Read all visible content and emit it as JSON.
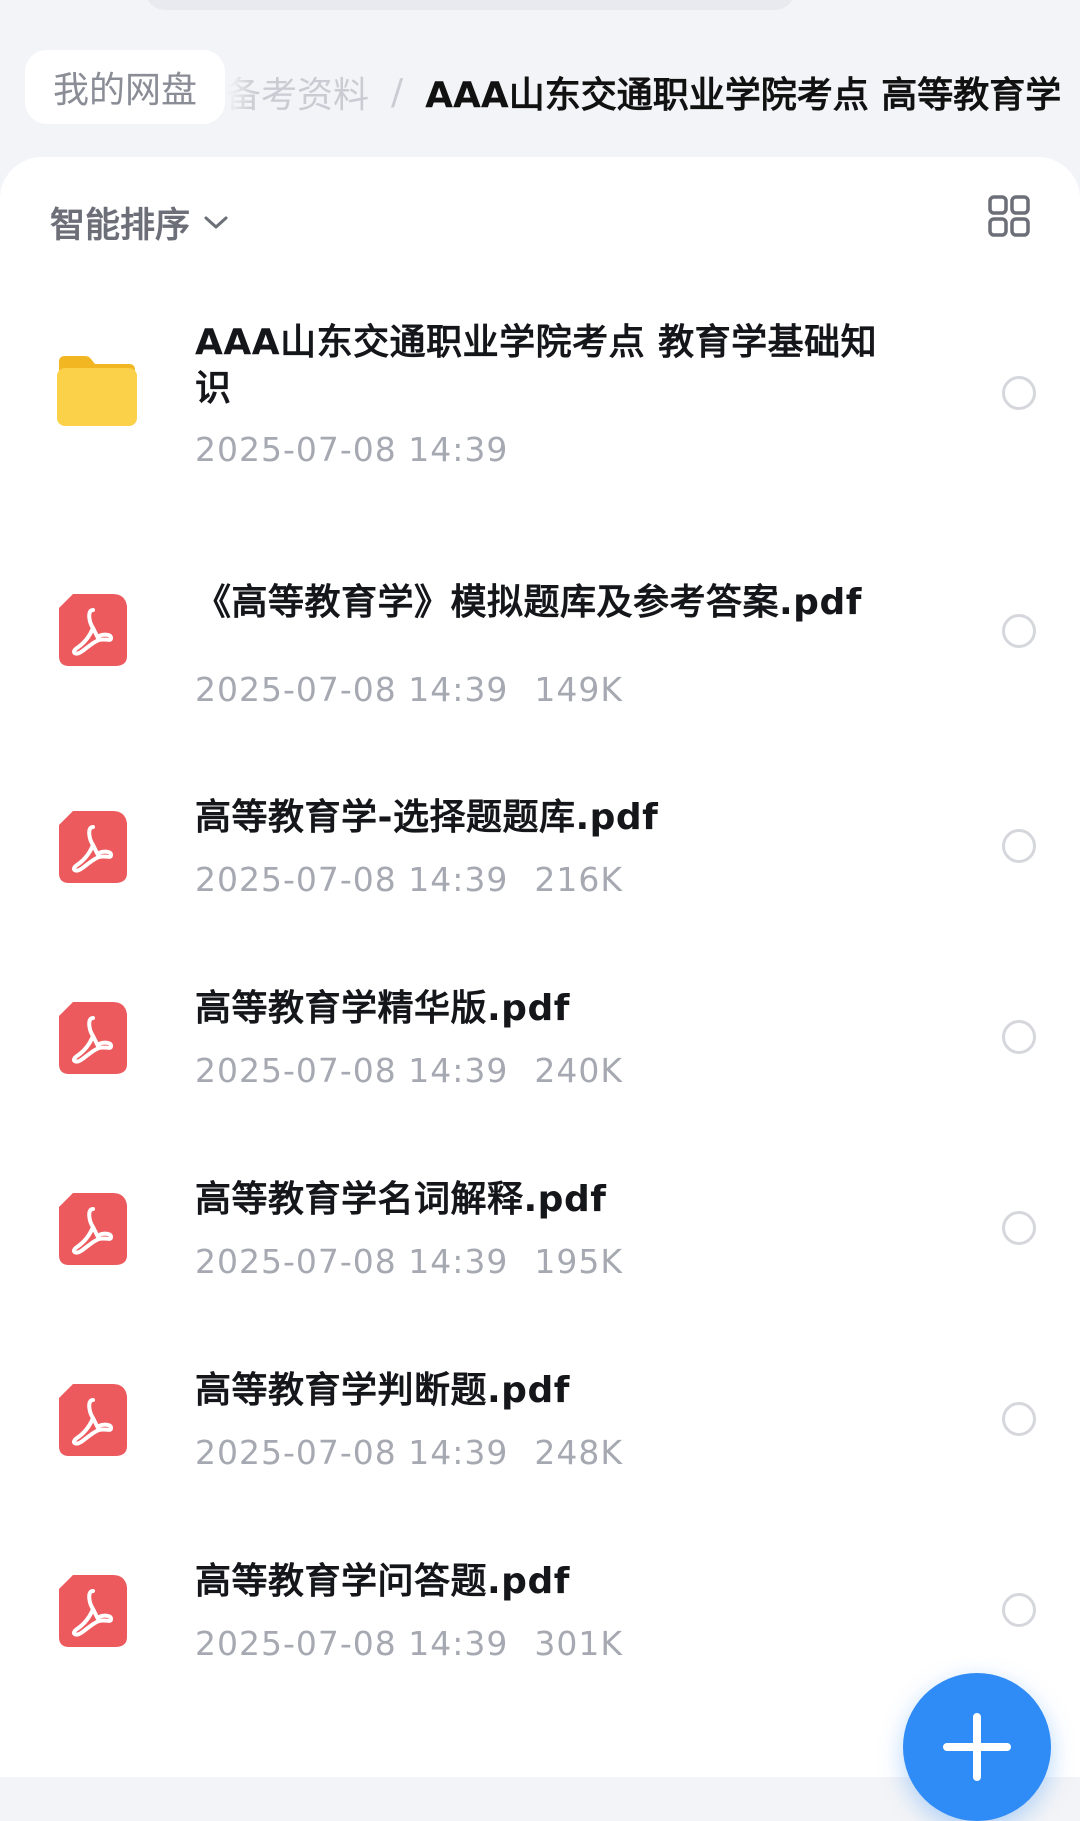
{
  "breadcrumb": {
    "root": "我的网盘",
    "previous": "备考资料",
    "separator": "/",
    "current": "AAA山东交通职业学院考点 高等教育学"
  },
  "toolbar": {
    "sort_label": "智能排序",
    "sort_icon": "chevron-down-icon",
    "view_icon": "grid-view-icon"
  },
  "files": [
    {
      "type": "folder",
      "name": "AAA山东交通职业学院考点 教育学基础知识",
      "date": "2025-07-08 14:39",
      "size": ""
    },
    {
      "type": "pdf",
      "name": "《高等教育学》模拟题库及参考答案.pdf",
      "date": "2025-07-08 14:39",
      "size": "149K"
    },
    {
      "type": "pdf",
      "name": "高等教育学-选择题题库.pdf",
      "date": "2025-07-08 14:39",
      "size": "216K"
    },
    {
      "type": "pdf",
      "name": "高等教育学精华版.pdf",
      "date": "2025-07-08 14:39",
      "size": "240K"
    },
    {
      "type": "pdf",
      "name": "高等教育学名词解释.pdf",
      "date": "2025-07-08 14:39",
      "size": "195K"
    },
    {
      "type": "pdf",
      "name": "高等教育学判断题.pdf",
      "date": "2025-07-08 14:39",
      "size": "248K"
    },
    {
      "type": "pdf",
      "name": "高等教育学问答题.pdf",
      "date": "2025-07-08 14:39",
      "size": "301K"
    }
  ],
  "fab": {
    "icon": "plus-icon"
  },
  "colors": {
    "accent": "#2f8bf5",
    "pdf": "#ec5a5e",
    "folder": "#f8c734"
  }
}
